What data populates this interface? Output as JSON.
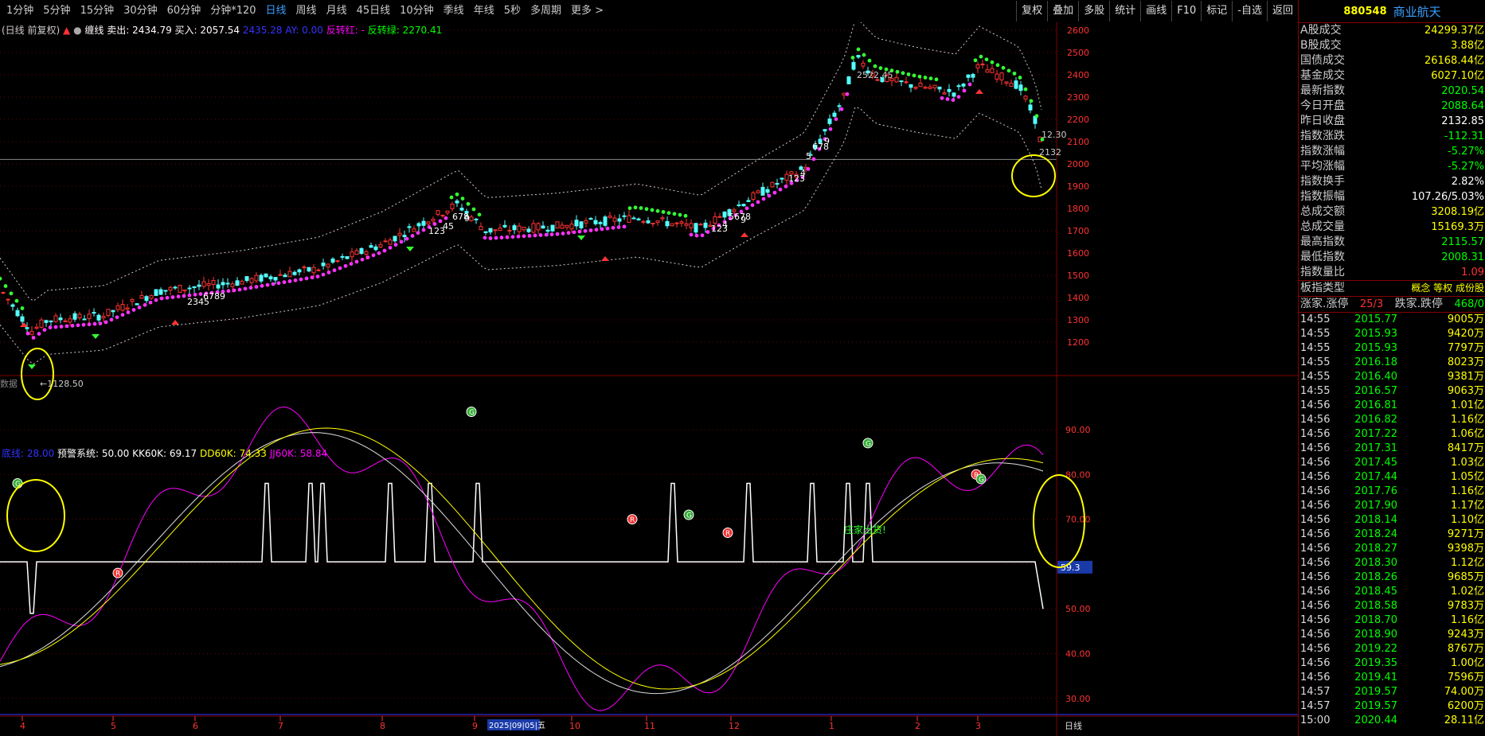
{
  "toolbar": {
    "periods": [
      "1分钟",
      "5分钟",
      "15分钟",
      "30分钟",
      "60分钟",
      "分钟*120",
      "日线",
      "周线",
      "月线",
      "45日线",
      "10分钟",
      "季线",
      "年线",
      "5秒",
      "多周期",
      "更多 >"
    ],
    "active_index": 6,
    "right_buttons": [
      "复权",
      "叠加",
      "多股",
      "统计",
      "画线",
      "F10",
      "标记",
      "-自选",
      "返回"
    ]
  },
  "main_legend": {
    "prefix": "(日线 前复权)",
    "indicator": "缠线",
    "sell": "卖出: 2434.79",
    "buy": "买入: 2057.54",
    "blue_text": "2435.28 AY: 0.00",
    "red_green_label": "反转红: -",
    "green_label": "反转绿: 2270.41"
  },
  "sub_legend": {
    "first": "底线: 28.00",
    "warning": "预警系统: 50.00",
    "kk": "KK60K: 69.17",
    "dd": "DD60K: 74.33",
    "jj": "JJ60K: 58.84"
  },
  "price_axis": {
    "ticks": [
      "2600",
      "2500",
      "2400",
      "2300",
      "2200",
      "2100",
      "2000",
      "1900",
      "1800",
      "1700",
      "1600",
      "1500",
      "1400",
      "1300",
      "1200"
    ]
  },
  "sub_axis": {
    "ticks": [
      "90.00",
      "80.00",
      "70.00",
      "60.00",
      "50.00",
      "40.00",
      "30.00"
    ],
    "current": "59.3"
  },
  "date_axis": {
    "labels": [
      "4",
      "5",
      "6",
      "7",
      "8",
      "9",
      "10",
      "11",
      "12",
      "1",
      "2",
      "3"
    ],
    "highlight": "2025|09|05|五",
    "period": "日线"
  },
  "annotations": {
    "low_price": "1128.50",
    "high_price": "2522.45",
    "left_label": "数据",
    "zhuangjia": "庄家出货!",
    "right_label_1": "12.30",
    "right_label_2": "2132",
    "seq_labels": [
      "123",
      "45",
      "678",
      "9",
      "2345",
      "6789",
      "123",
      "4",
      "5678",
      "9",
      "123",
      "4",
      "5",
      "678",
      "9"
    ]
  },
  "panel": {
    "code": "880548",
    "name": "商业航天",
    "stats": [
      {
        "k": "A股成交",
        "v": "24299.37亿",
        "c": "#ff0"
      },
      {
        "k": "B股成交",
        "v": "3.88亿",
        "c": "#ff0"
      },
      {
        "k": "国债成交",
        "v": "26168.44亿",
        "c": "#ff0"
      },
      {
        "k": "基金成交",
        "v": "6027.10亿",
        "c": "#ff0"
      },
      {
        "k": "最新指数",
        "v": "2020.54",
        "c": "#0f0"
      },
      {
        "k": "今日开盘",
        "v": "2088.64",
        "c": "#0f0"
      },
      {
        "k": "昨日收盘",
        "v": "2132.85",
        "c": "#fff"
      },
      {
        "k": "指数涨跌",
        "v": "-112.31",
        "c": "#0f0"
      },
      {
        "k": "指数涨幅",
        "v": "-5.27%",
        "c": "#0f0"
      },
      {
        "k": "平均涨幅",
        "v": "-5.27%",
        "c": "#0f0"
      },
      {
        "k": "指数换手",
        "v": "2.82%",
        "c": "#fff"
      },
      {
        "k": "指数振幅",
        "v": "107.26/5.03%",
        "c": "#fff"
      },
      {
        "k": "总成交额",
        "v": "3208.19亿",
        "c": "#ff0"
      },
      {
        "k": "总成交量",
        "v": "15169.3万",
        "c": "#ff0"
      },
      {
        "k": "最高指数",
        "v": "2115.57",
        "c": "#0f0"
      },
      {
        "k": "最低指数",
        "v": "2008.31",
        "c": "#0f0"
      },
      {
        "k": "指数量比",
        "v": "1.09",
        "c": "#f33"
      }
    ],
    "board_type": {
      "k": "板指类型",
      "v": "概念 等权 成份股"
    },
    "rise_fall": {
      "k1": "涨家.涨停",
      "v1": "25/3",
      "k2": "跌家.跌停",
      "v2": "468/0"
    },
    "ticks": [
      {
        "t": "14:55",
        "p": "2015.77",
        "v": "9005万"
      },
      {
        "t": "14:55",
        "p": "2015.93",
        "v": "9420万"
      },
      {
        "t": "14:55",
        "p": "2015.93",
        "v": "7797万"
      },
      {
        "t": "14:55",
        "p": "2016.18",
        "v": "8023万"
      },
      {
        "t": "14:55",
        "p": "2016.40",
        "v": "9381万"
      },
      {
        "t": "14:55",
        "p": "2016.57",
        "v": "9063万"
      },
      {
        "t": "14:56",
        "p": "2016.81",
        "v": "1.01亿"
      },
      {
        "t": "14:56",
        "p": "2016.82",
        "v": "1.16亿"
      },
      {
        "t": "14:56",
        "p": "2017.22",
        "v": "1.06亿"
      },
      {
        "t": "14:56",
        "p": "2017.31",
        "v": "8417万"
      },
      {
        "t": "14:56",
        "p": "2017.45",
        "v": "1.03亿"
      },
      {
        "t": "14:56",
        "p": "2017.44",
        "v": "1.05亿"
      },
      {
        "t": "14:56",
        "p": "2017.76",
        "v": "1.16亿"
      },
      {
        "t": "14:56",
        "p": "2017.90",
        "v": "1.17亿"
      },
      {
        "t": "14:56",
        "p": "2018.14",
        "v": "1.10亿"
      },
      {
        "t": "14:56",
        "p": "2018.24",
        "v": "9271万"
      },
      {
        "t": "14:56",
        "p": "2018.27",
        "v": "9398万"
      },
      {
        "t": "14:56",
        "p": "2018.30",
        "v": "1.12亿"
      },
      {
        "t": "14:56",
        "p": "2018.26",
        "v": "9685万"
      },
      {
        "t": "14:56",
        "p": "2018.45",
        "v": "1.02亿"
      },
      {
        "t": "14:56",
        "p": "2018.58",
        "v": "9783万"
      },
      {
        "t": "14:56",
        "p": "2018.70",
        "v": "1.16亿"
      },
      {
        "t": "14:56",
        "p": "2018.90",
        "v": "9243万"
      },
      {
        "t": "14:56",
        "p": "2019.22",
        "v": "8767万"
      },
      {
        "t": "14:56",
        "p": "2019.35",
        "v": "1.00亿"
      },
      {
        "t": "14:56",
        "p": "2019.41",
        "v": "7596万"
      },
      {
        "t": "14:57",
        "p": "2019.57",
        "v": "74.00万"
      },
      {
        "t": "14:57",
        "p": "2019.57",
        "v": "6200万"
      },
      {
        "t": "15:00",
        "p": "2020.44",
        "v": "28.11亿"
      }
    ]
  }
}
